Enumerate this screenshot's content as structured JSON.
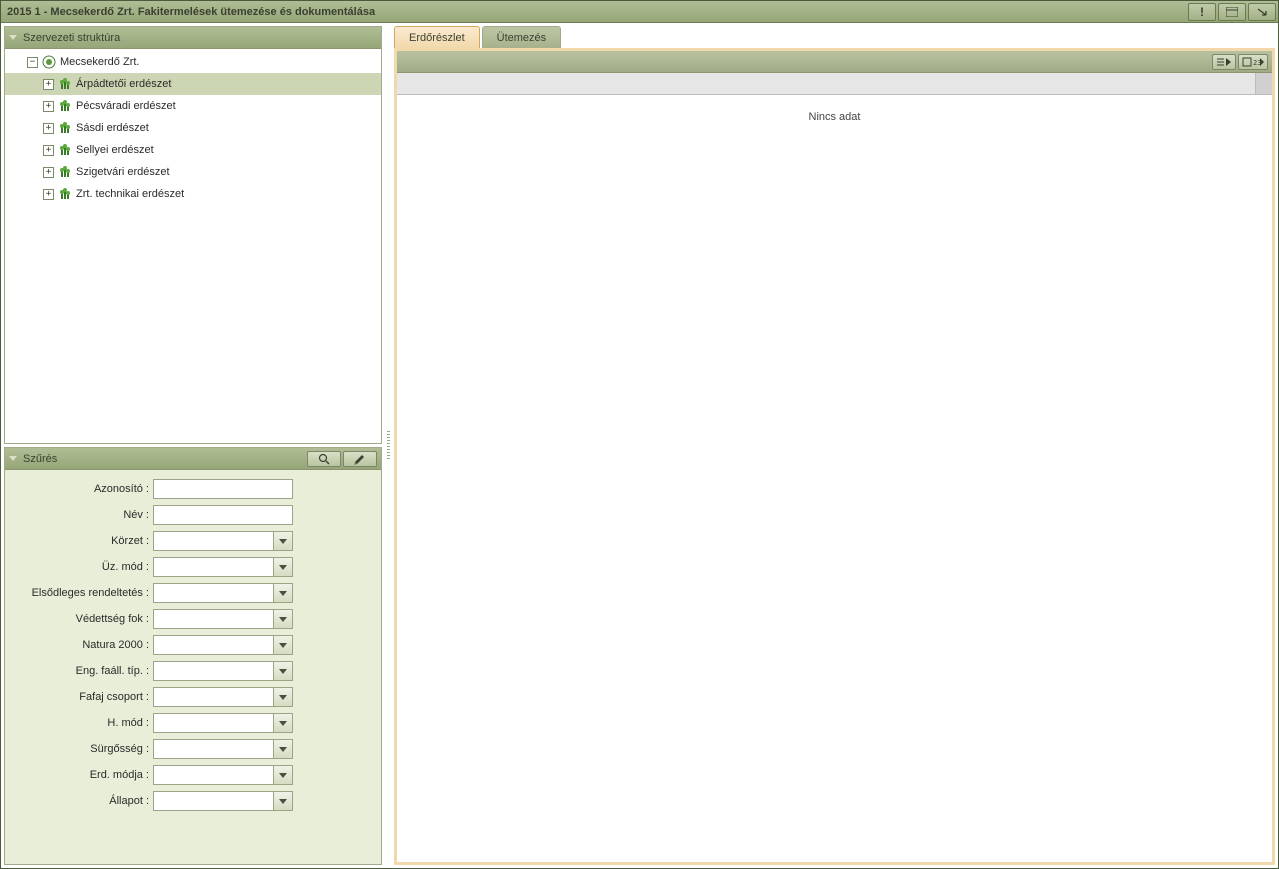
{
  "window": {
    "title": "2015 1 - Mecsekerdő Zrt. Fakitermelések ütemezése és dokumentálása"
  },
  "sidebar": {
    "structure_title": "Szervezeti struktúra",
    "root": {
      "label": "Mecsekerdő Zrt.",
      "expanded": true,
      "children": [
        {
          "label": "Árpádtetői erdészet",
          "selected": true
        },
        {
          "label": "Pécsváradi erdészet",
          "selected": false
        },
        {
          "label": "Sásdi erdészet",
          "selected": false
        },
        {
          "label": "Sellyei erdészet",
          "selected": false
        },
        {
          "label": "Szigetvári erdészet",
          "selected": false
        },
        {
          "label": "Zrt. technikai erdészet",
          "selected": false
        }
      ]
    }
  },
  "filter": {
    "title": "Szűrés",
    "fields": [
      {
        "label": "Azonosító :",
        "type": "text",
        "value": ""
      },
      {
        "label": "Név :",
        "type": "text",
        "value": ""
      },
      {
        "label": "Körzet :",
        "type": "select",
        "value": ""
      },
      {
        "label": "Üz. mód :",
        "type": "select",
        "value": ""
      },
      {
        "label": "Elsődleges rendeltetés :",
        "type": "select",
        "value": ""
      },
      {
        "label": "Védettség fok :",
        "type": "select",
        "value": ""
      },
      {
        "label": "Natura 2000 :",
        "type": "select",
        "value": ""
      },
      {
        "label": "Eng. faáll. típ. :",
        "type": "select",
        "value": ""
      },
      {
        "label": "Fafaj csoport :",
        "type": "select",
        "value": ""
      },
      {
        "label": "H. mód :",
        "type": "select",
        "value": ""
      },
      {
        "label": "Sürgősség :",
        "type": "select",
        "value": ""
      },
      {
        "label": "Erd. módja :",
        "type": "select",
        "value": ""
      },
      {
        "label": "Állapot :",
        "type": "select",
        "value": ""
      }
    ]
  },
  "main": {
    "tabs": [
      {
        "label": "Erdőrészlet",
        "active": true
      },
      {
        "label": "Ütemezés",
        "active": false
      }
    ],
    "grid": {
      "empty_text": "Nincs adat"
    }
  }
}
